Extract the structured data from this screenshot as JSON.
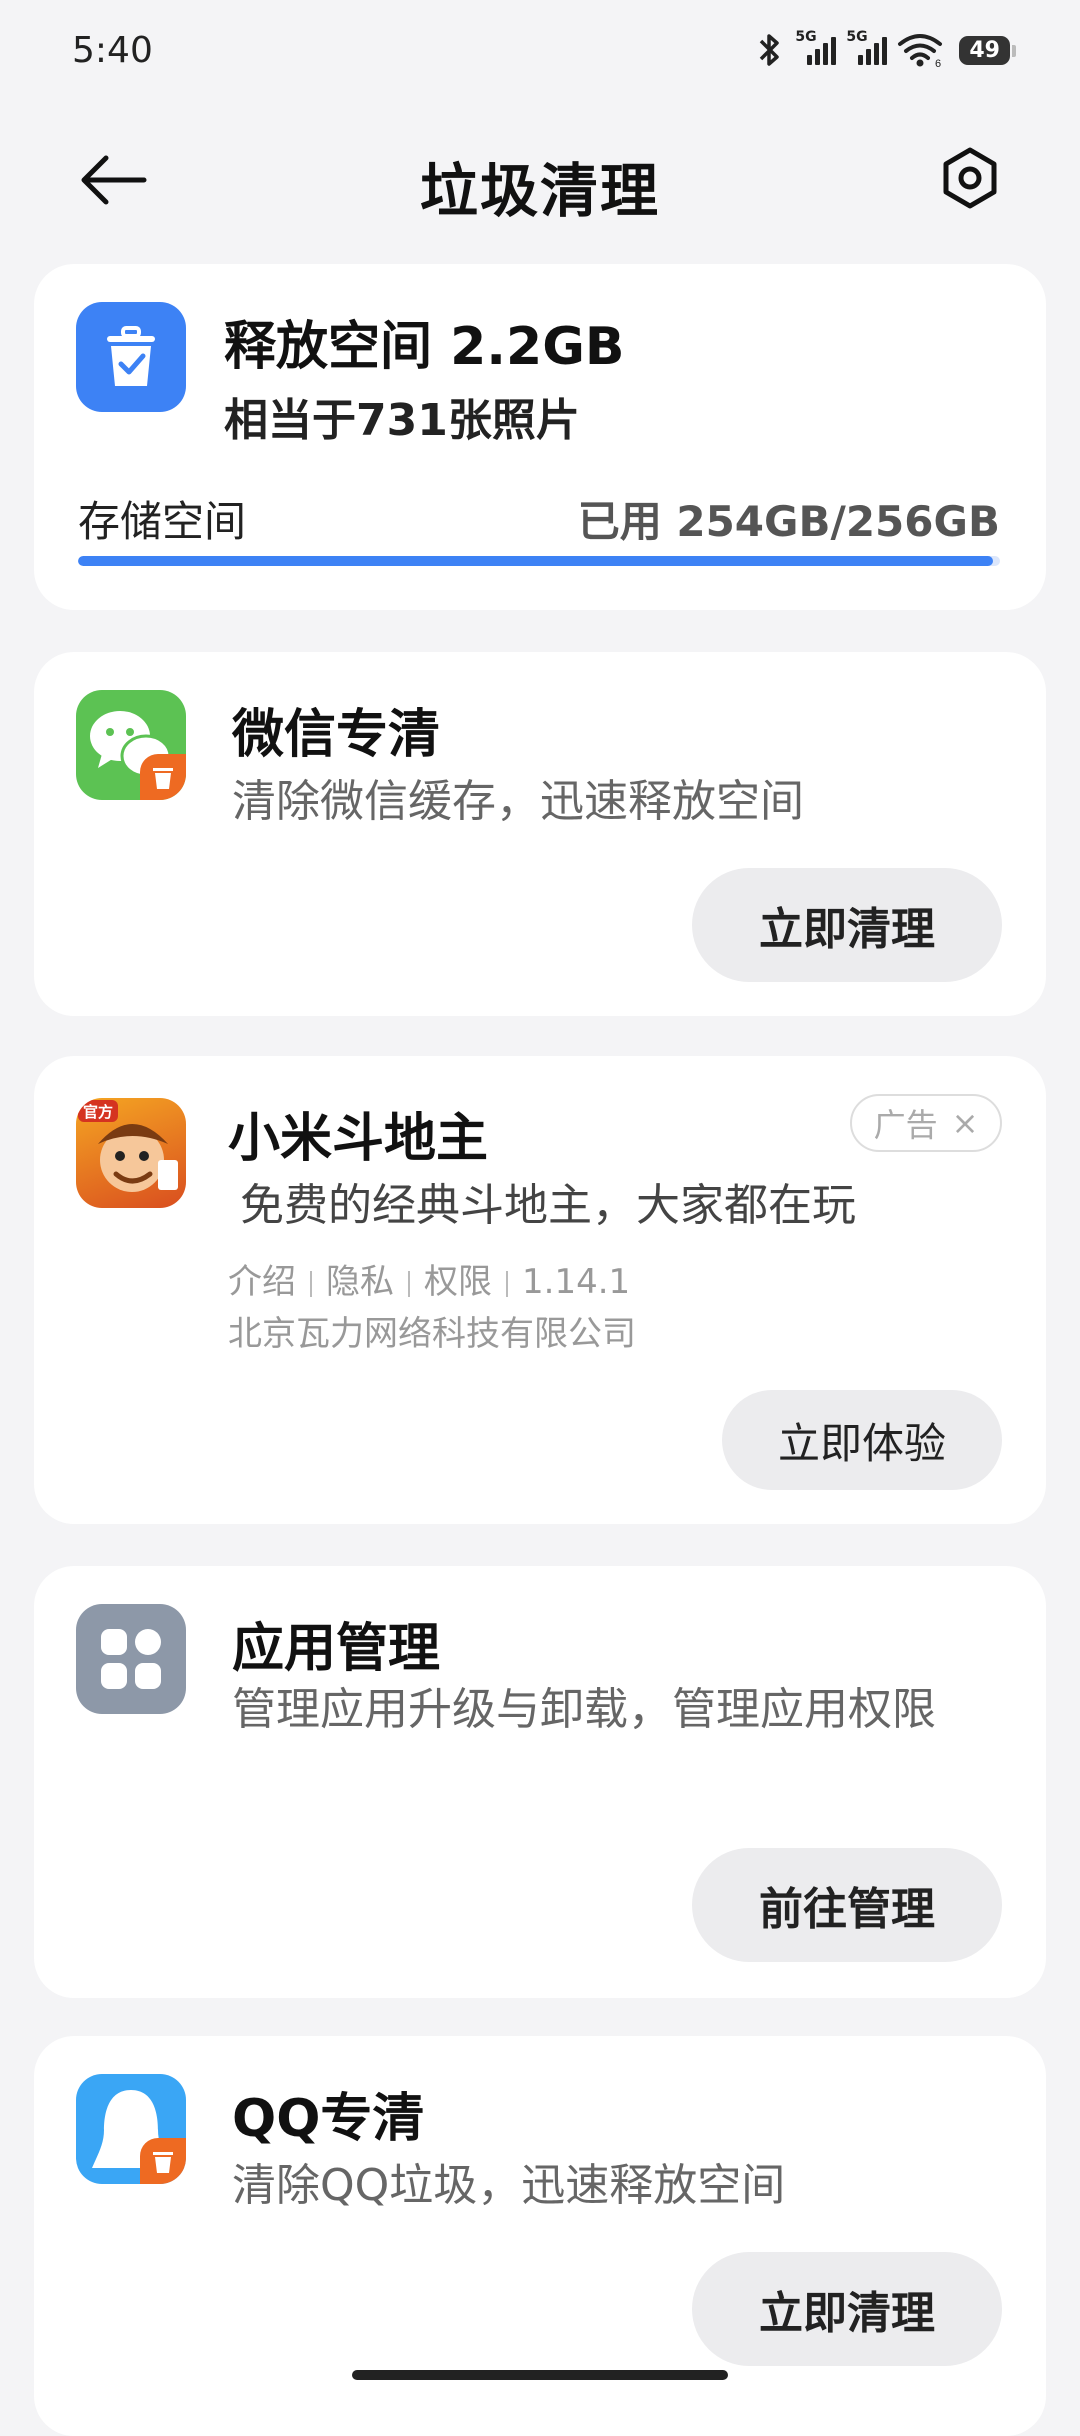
{
  "status_bar": {
    "time": "5:40",
    "battery": "49",
    "network_tag_1": "5G",
    "network_tag_2": "5G",
    "wifi_tag": "6"
  },
  "header": {
    "title": "垃圾清理"
  },
  "storage": {
    "release_label": "释放空间 2.2GB",
    "equivalent": "相当于731张照片",
    "storage_label": "存储空间",
    "used_text": "已用 254GB/256GB",
    "used_fraction": 0.992,
    "accent": "#3d82f5"
  },
  "wechat_card": {
    "title": "微信专清",
    "description": "清除微信缓存，迅速释放空间",
    "button": "立即清理"
  },
  "ad_card": {
    "title": "小米斗地主",
    "badge": "广告",
    "badge_close": "×",
    "icon_text": "官方",
    "description": "免费的经典斗地主，大家都在玩",
    "meta_links": [
      "介绍",
      "隐私",
      "权限",
      "1.14.1"
    ],
    "developer": "北京瓦力网络科技有限公司",
    "button": "立即体验"
  },
  "appmgr_card": {
    "title": "应用管理",
    "description": "管理应用升级与卸载，管理应用权限",
    "button": "前往管理"
  },
  "qq_card": {
    "title": "QQ专清",
    "description": "清除QQ垃圾，迅速释放空间",
    "button": "立即清理"
  }
}
